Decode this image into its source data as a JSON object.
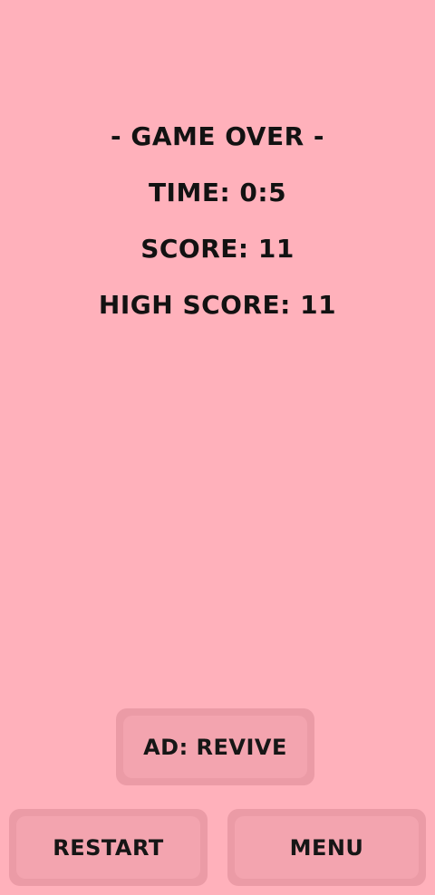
{
  "game_over": {
    "title": "- GAME OVER -",
    "time": "TIME: 0:5",
    "score": "SCORE: 11",
    "high_score": "HIGH SCORE: 11"
  },
  "buttons": {
    "revive_label": "AD: REVIVE",
    "restart_label": "RESTART",
    "menu_label": "MENU"
  },
  "colors": {
    "background": "#ffb1bb",
    "button_border": "#eb9ba6",
    "button_face": "#f3a4af",
    "text": "#121212"
  }
}
